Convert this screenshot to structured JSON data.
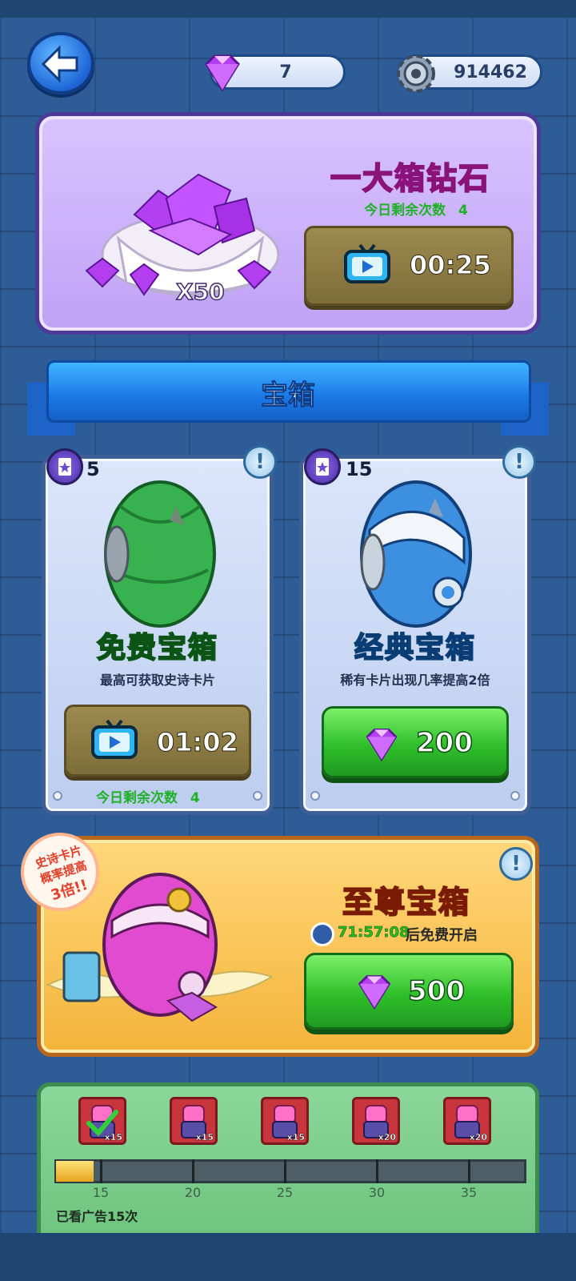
{
  "top_bar": {
    "gems": "7",
    "gears": "914462"
  },
  "diamond_box": {
    "title": "一大箱钻石",
    "remaining_label": "今日剩余次数",
    "remaining_count": "4",
    "ad_timer": "00:25",
    "quantity": "X50"
  },
  "section_banner": {
    "label": "宝箱"
  },
  "chests": [
    {
      "card_count": "5",
      "name": "免费宝箱",
      "name_color": "#2bd14a",
      "description": "最高可获取史诗卡片",
      "ad_timer": "01:02",
      "remaining_label": "今日剩余次数",
      "remaining_count": "4"
    },
    {
      "card_count": "15",
      "name": "经典宝箱",
      "name_color": "#27b7ff",
      "description": "稀有卡片出现几率提高2倍",
      "price": "200"
    }
  ],
  "supreme_chest": {
    "title": "至尊宝箱",
    "timer": "71:57:08",
    "timer_suffix": "后免费开启",
    "price": "500",
    "promo": [
      "史诗卡片",
      "概率提高",
      "3倍!!"
    ]
  },
  "ad_progress": {
    "rewards": [
      "x15",
      "x15",
      "x15",
      "x20",
      "x20"
    ],
    "ticks": [
      "15",
      "20",
      "25",
      "30",
      "35"
    ],
    "progress_fraction": 0.08,
    "watched_label": "已看广告15次"
  },
  "colors": {
    "accent_green": "#22b02a",
    "diamond_title": "#ff3fc7",
    "supreme_title": "#ff4a18"
  }
}
